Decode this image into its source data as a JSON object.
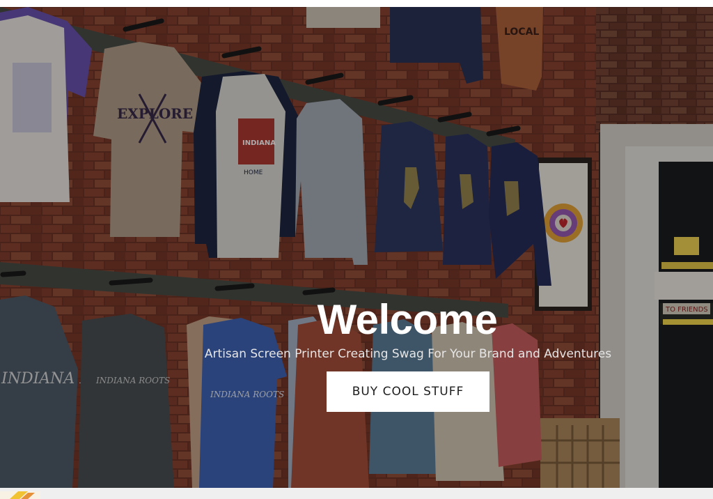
{
  "hero": {
    "title": "Welcome",
    "subtitle": "Artisan Screen Printer Creating Swag For Your Brand and Adventures",
    "cta_label": "BUY COOL STUFF",
    "background_alt": "Screen-printed shirts hanging on a brick wall in a shop",
    "shirt_prints": {
      "explore": "EXPLORE",
      "indiana_badge": "INDIANA",
      "home": "HOME",
      "local": "LOCAL",
      "indiana_roots_1": "INDIANA ROOTS",
      "indiana_roots_2": "INDIANA ROOTS",
      "indiana_roots_3": "INDIANA ROOTS",
      "window_sign": "TO FRIENDS"
    }
  },
  "colors": {
    "overlay": "#000000",
    "cta_bg": "#ffffff",
    "cta_text": "#1c1c1c",
    "brick": "#7a3b2a"
  }
}
